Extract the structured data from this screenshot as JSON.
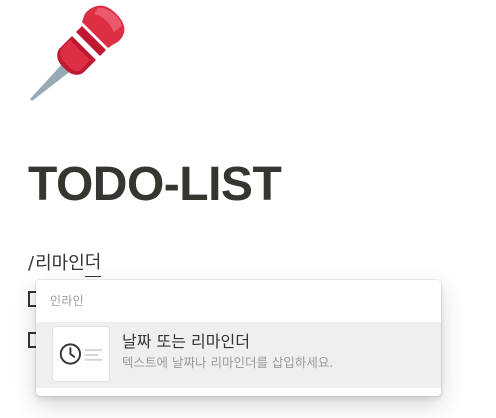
{
  "page": {
    "icon": "pushpin-icon",
    "title": "TODO-LIST"
  },
  "editor": {
    "command_slash": "/",
    "command_typed_prefix": "리마인",
    "command_typed_underlined": "더"
  },
  "todos": [
    {
      "checked": false
    },
    {
      "checked": false
    }
  ],
  "inline_menu": {
    "section_label": "인라인",
    "items": [
      {
        "icon": "clock-icon",
        "title": "날짜 또는 리마인더",
        "description": "텍스트에 날짜나 리마인더를 삽입하세요."
      }
    ]
  },
  "colors": {
    "text": "#37352f",
    "muted": "#9b9a97",
    "hover_bg": "#efefee",
    "pin_red": "#e0334d"
  }
}
